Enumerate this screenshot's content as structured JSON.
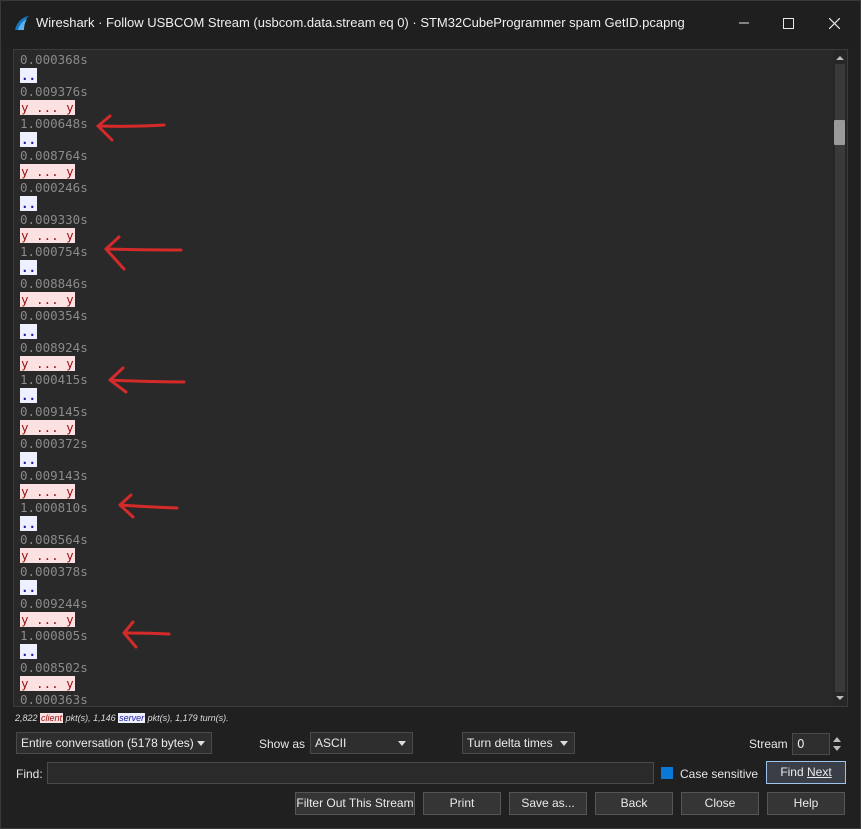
{
  "window": {
    "title": "Wireshark · Follow USBCOM Stream (usbcom.data.stream eq 0) · STM32CubeProgrammer spam GetID.pcapng",
    "controls": [
      "minimize-icon",
      "maximize-icon",
      "close-icon"
    ]
  },
  "stream": {
    "lines": [
      {
        "kind": "ts",
        "text": "0.000368s"
      },
      {
        "kind": "srv",
        "text": ".."
      },
      {
        "kind": "ts",
        "text": "0.009376s"
      },
      {
        "kind": "cli",
        "text": "y ... y"
      },
      {
        "kind": "ts",
        "text": "1.000648s"
      },
      {
        "kind": "srv",
        "text": ".."
      },
      {
        "kind": "ts",
        "text": "0.008764s"
      },
      {
        "kind": "cli",
        "text": "y ... y"
      },
      {
        "kind": "ts",
        "text": "0.000246s"
      },
      {
        "kind": "srv",
        "text": ".."
      },
      {
        "kind": "ts",
        "text": "0.009330s"
      },
      {
        "kind": "cli",
        "text": "y ... y"
      },
      {
        "kind": "ts",
        "text": "1.000754s"
      },
      {
        "kind": "srv",
        "text": ".."
      },
      {
        "kind": "ts",
        "text": "0.008846s"
      },
      {
        "kind": "cli",
        "text": "y ... y"
      },
      {
        "kind": "ts",
        "text": "0.000354s"
      },
      {
        "kind": "srv",
        "text": ".."
      },
      {
        "kind": "ts",
        "text": "0.008924s"
      },
      {
        "kind": "cli",
        "text": "y ... y"
      },
      {
        "kind": "ts",
        "text": "1.000415s"
      },
      {
        "kind": "srv",
        "text": ".."
      },
      {
        "kind": "ts",
        "text": "0.009145s"
      },
      {
        "kind": "cli",
        "text": "y ... y"
      },
      {
        "kind": "ts",
        "text": "0.000372s"
      },
      {
        "kind": "srv",
        "text": ".."
      },
      {
        "kind": "ts",
        "text": "0.009143s"
      },
      {
        "kind": "cli",
        "text": "y ... y"
      },
      {
        "kind": "ts",
        "text": "1.000810s"
      },
      {
        "kind": "srv",
        "text": ".."
      },
      {
        "kind": "ts",
        "text": "0.008564s"
      },
      {
        "kind": "cli",
        "text": "y ... y"
      },
      {
        "kind": "ts",
        "text": "0.000378s"
      },
      {
        "kind": "srv",
        "text": ".."
      },
      {
        "kind": "ts",
        "text": "0.009244s"
      },
      {
        "kind": "cli",
        "text": "y ... y"
      },
      {
        "kind": "ts",
        "text": "1.000805s"
      },
      {
        "kind": "srv",
        "text": ".."
      },
      {
        "kind": "ts",
        "text": "0.008502s"
      },
      {
        "kind": "cli",
        "text": "y ... y"
      },
      {
        "kind": "ts",
        "text": "0.000363s"
      }
    ],
    "annotation_color": "#d42a2a",
    "client_colors": {
      "bg": "#fbe1e1",
      "fg": "#9b1010"
    },
    "server_colors": {
      "bg": "#eef0ff",
      "fg": "#1a1aa6"
    }
  },
  "stats": {
    "client_pkts": "2,822",
    "client_tag": "client",
    "pkts_suffix_1": " pkt(s), 1,146 ",
    "server_tag": "server",
    "pkts_suffix_2": " pkt(s), 1,179 turn(s)."
  },
  "controls": {
    "conversation_select": "Entire conversation (5178 bytes)",
    "show_as_label": "Show as",
    "show_as_select": "ASCII",
    "time_select": "Turn delta times",
    "stream_label": "Stream",
    "stream_value": "0",
    "find_label": "Find:",
    "find_value": "",
    "case_sensitive_label": "Case sensitive",
    "find_next_pre": "Find ",
    "find_next_u": "Next"
  },
  "buttons": {
    "filter_out": "Filter Out This Stream",
    "print": "Print",
    "save_as": "Save as...",
    "back": "Back",
    "close": "Close",
    "help": "Help"
  },
  "accent": "#0a78d7"
}
